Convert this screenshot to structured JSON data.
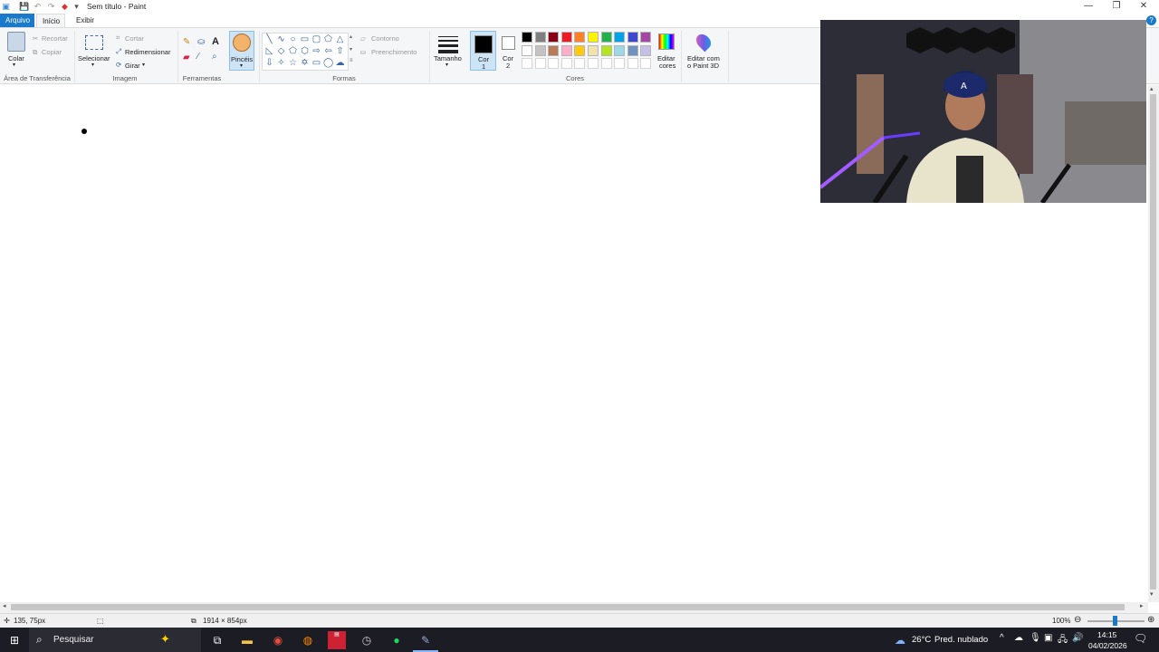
{
  "window": {
    "title": "Sem título - Paint",
    "controls": {
      "minimize": "—",
      "maximize": "❐",
      "close": "✕"
    }
  },
  "menu": {
    "file": "Arquivo",
    "tabs": [
      "Início",
      "Exibir"
    ]
  },
  "ribbon": {
    "clipboard": {
      "paste": "Colar",
      "cut": "Recortar",
      "copy": "Copiar",
      "group": "Área de Transferência"
    },
    "image": {
      "select": "Selecionar",
      "crop": "Cortar",
      "resize": "Redimensionar",
      "rotate": "Girar",
      "group": "Imagem"
    },
    "tools": {
      "group": "Ferramentas",
      "brushes": "Pincéis"
    },
    "shapes": {
      "outline": "Contorno",
      "fill": "Preenchimento",
      "group": "Formas"
    },
    "size": "Tamanho",
    "colors": {
      "color1_line1": "Cor",
      "color1_line2": "1",
      "color2_line1": "Cor",
      "color2_line2": "2",
      "edit_line1": "Editar",
      "edit_line2": "cores",
      "group": "Cores",
      "palette_row1": [
        "#000000",
        "#7f7f7f",
        "#880015",
        "#ed1c24",
        "#ff7f27",
        "#fff200",
        "#22b14c",
        "#00a2e8",
        "#3f48cc",
        "#a349a4"
      ],
      "palette_row2": [
        "#ffffff",
        "#c3c3c3",
        "#b97a57",
        "#ffaec9",
        "#ffc90e",
        "#efe4b0",
        "#b5e61d",
        "#99d9ea",
        "#7092be",
        "#c8bfe7"
      ]
    },
    "paint3d_line1": "Editar com",
    "paint3d_line2": "o Paint 3D"
  },
  "status": {
    "cursor_pos": "135, 75px",
    "canvas_size": "1914 × 854px",
    "zoom": "100%"
  },
  "taskbar": {
    "search_placeholder": "Pesquisar",
    "weather_temp": "26°C",
    "weather_text": "Pred. nublado",
    "time": "14:15",
    "date": "04/02/2026",
    "icons": [
      "start-icon",
      "search-icon",
      "task-view-icon",
      "file-explorer-icon",
      "chrome-icon",
      "firefox-icon",
      "voice-app-icon",
      "clock-app-icon",
      "spotify-icon",
      "paint-icon"
    ]
  }
}
